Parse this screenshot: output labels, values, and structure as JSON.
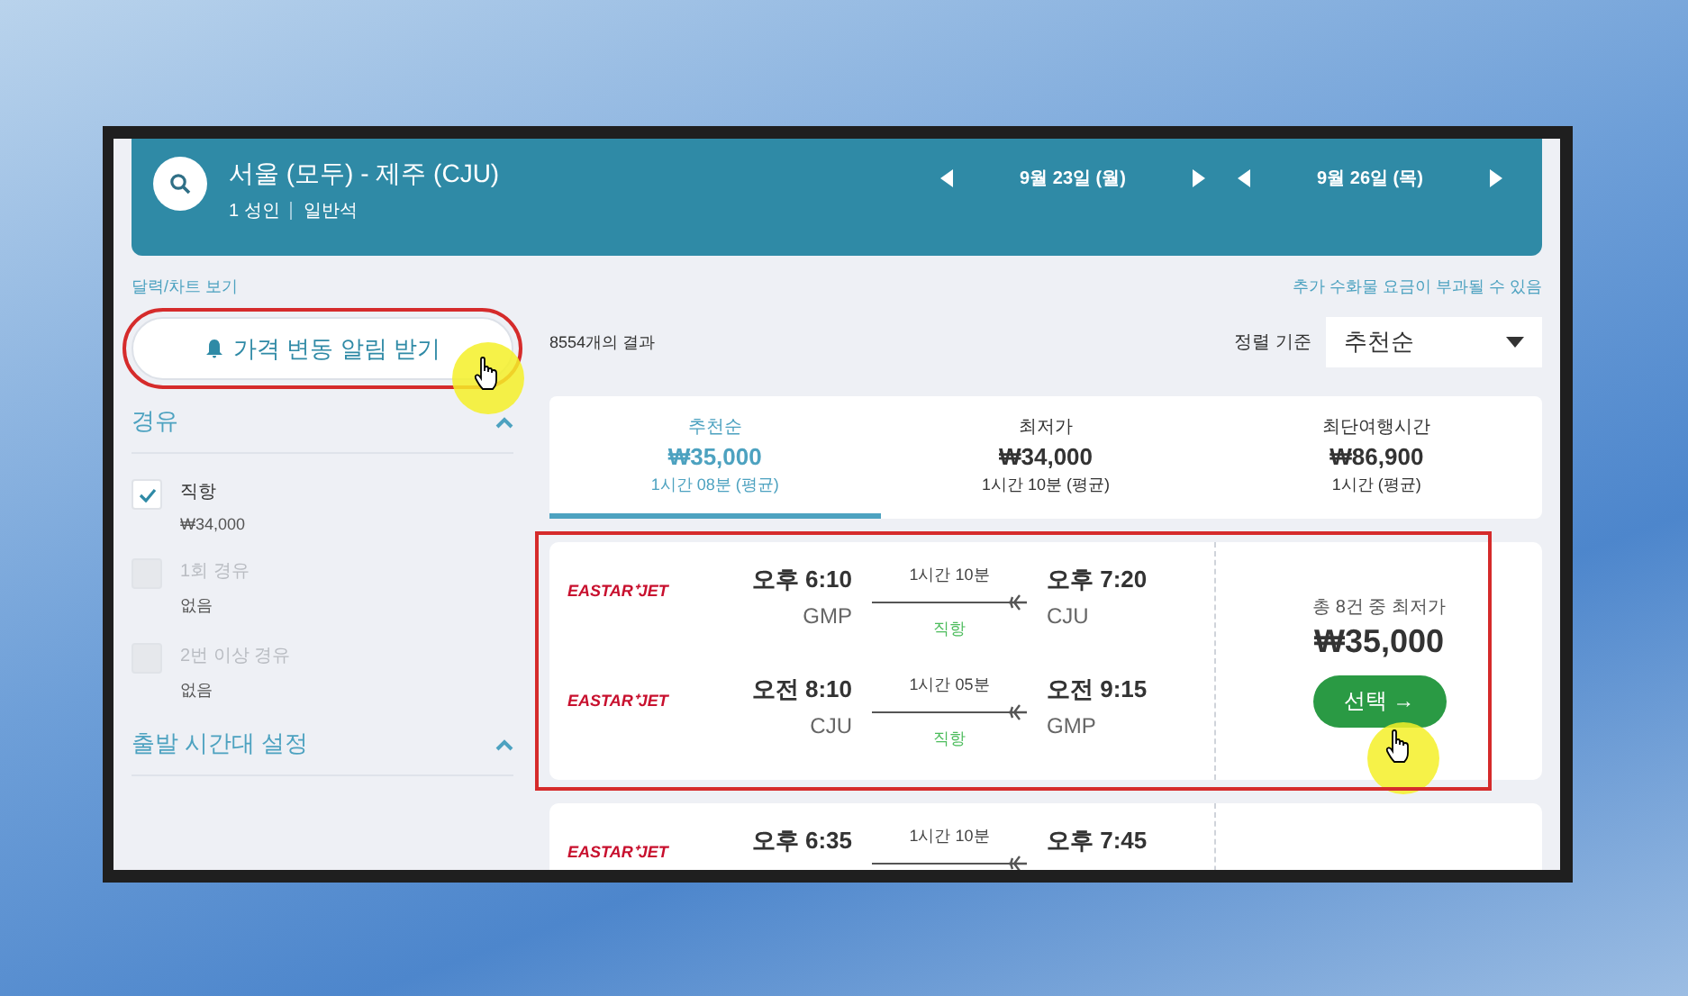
{
  "header": {
    "route": "서울 (모두) - 제주 (CJU)",
    "passengers": "1 성인",
    "cabin": "일반석",
    "dates": [
      "9월 23일 (월)",
      "9월 26일 (목)"
    ]
  },
  "calendar_link": "달력/차트 보기",
  "baggage_note": "추가 수화물 요금이 부과될 수 있음",
  "alert_button": {
    "label": "가격 변동 알림 받기",
    "highlighted": true
  },
  "filters": [
    {
      "title": "경유",
      "expanded": true,
      "options": [
        {
          "label": "직항",
          "price": "₩34,000",
          "checked": true,
          "disabled": false
        },
        {
          "label": "1회 경유",
          "price": "없음",
          "checked": false,
          "disabled": true
        },
        {
          "label": "2번 이상 경유",
          "price": "없음",
          "checked": false,
          "disabled": true
        }
      ]
    },
    {
      "title": "출발 시간대 설정",
      "expanded": true
    }
  ],
  "results_count": "8554개의 결과",
  "sort": {
    "label": "정렬 기준",
    "value": "추천순"
  },
  "tabs": [
    {
      "label": "추천순",
      "price": "₩35,000",
      "duration": "1시간 08분 (평균)",
      "selected": true
    },
    {
      "label": "최저가",
      "price": "₩34,000",
      "duration": "1시간 10분 (평균)",
      "selected": false
    },
    {
      "label": "최단여행시간",
      "price": "₩86,900",
      "duration": "1시간 (평균)",
      "selected": false
    }
  ],
  "results": [
    {
      "highlighted": true,
      "legs": [
        {
          "airline": "EASTAR⁺JET",
          "dep_time": "오후 6:10",
          "dep_airport": "GMP",
          "duration": "1시간 10분",
          "stops": "직항",
          "arr_time": "오후 7:20",
          "arr_airport": "CJU"
        },
        {
          "airline": "EASTAR⁺JET",
          "dep_time": "오전 8:10",
          "dep_airport": "CJU",
          "duration": "1시간 05분",
          "stops": "직항",
          "arr_time": "오전 9:15",
          "arr_airport": "GMP"
        }
      ],
      "summary": {
        "note": "총 8건 중 최저가",
        "price": "₩35,000",
        "button": "선택 →"
      }
    },
    {
      "highlighted": false,
      "legs": [
        {
          "airline": "EASTAR⁺JET",
          "dep_time": "오후 6:35",
          "duration": "1시간 10분",
          "arr_time": "오후 7:45"
        }
      ]
    }
  ]
}
